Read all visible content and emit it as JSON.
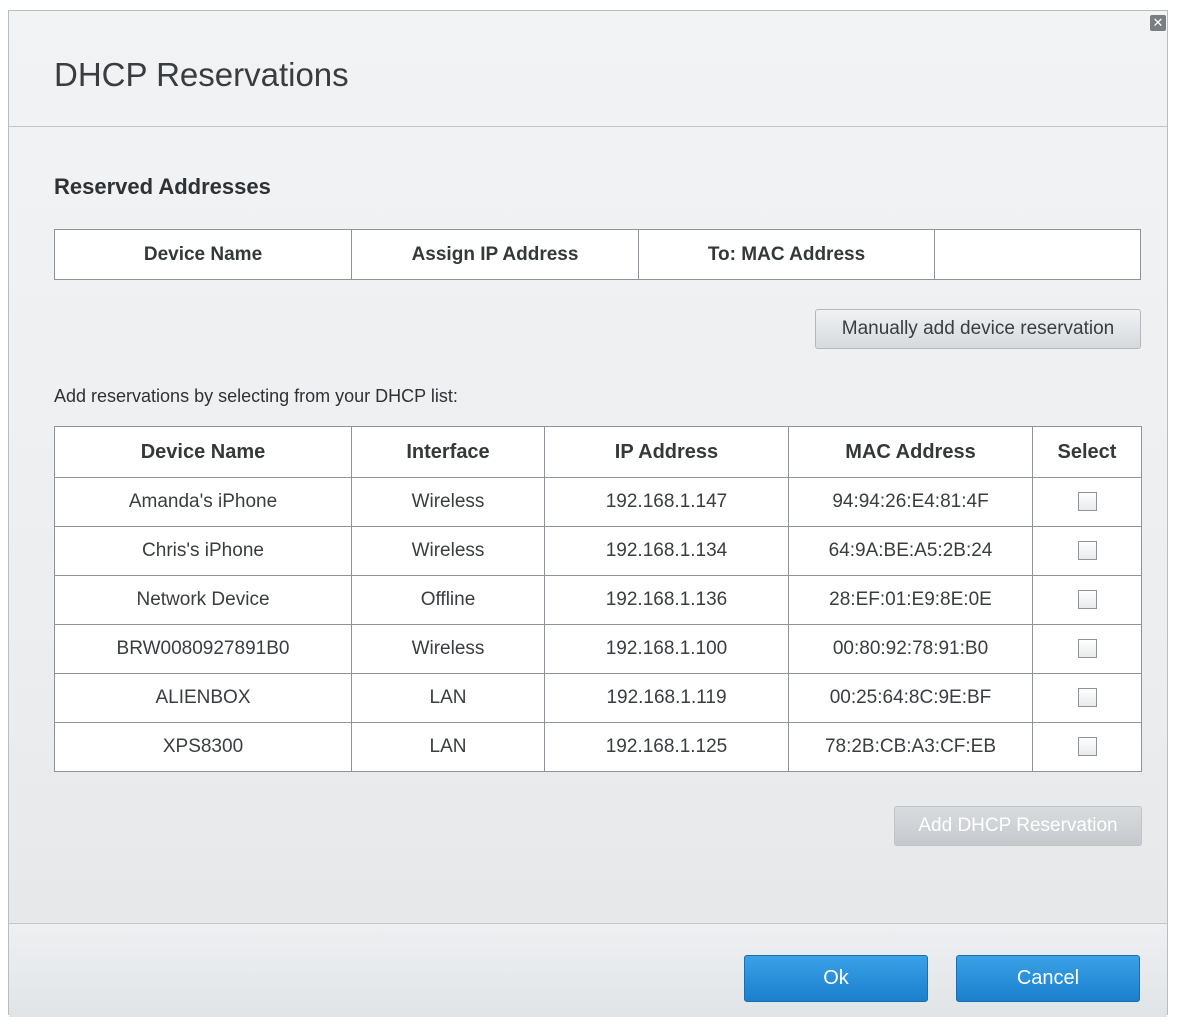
{
  "dialog": {
    "title": "DHCP Reservations",
    "close_glyph": "✕"
  },
  "reserved": {
    "section_title": "Reserved Addresses",
    "columns": [
      "Device Name",
      "Assign IP Address",
      "To: MAC Address",
      ""
    ],
    "manual_add_label": "Manually add device reservation"
  },
  "dhcp_list": {
    "hint": "Add reservations by selecting from your DHCP list:",
    "columns": [
      "Device Name",
      "Interface",
      "IP Address",
      "MAC Address",
      "Select"
    ],
    "rows": [
      {
        "device": "Amanda's iPhone",
        "interface": "Wireless",
        "ip": "192.168.1.147",
        "mac": "94:94:26:E4:81:4F",
        "selected": false
      },
      {
        "device": "Chris's iPhone",
        "interface": "Wireless",
        "ip": "192.168.1.134",
        "mac": "64:9A:BE:A5:2B:24",
        "selected": false
      },
      {
        "device": "Network Device",
        "interface": "Offline",
        "ip": "192.168.1.136",
        "mac": "28:EF:01:E9:8E:0E",
        "selected": false
      },
      {
        "device": "BRW0080927891B0",
        "interface": "Wireless",
        "ip": "192.168.1.100",
        "mac": "00:80:92:78:91:B0",
        "selected": false
      },
      {
        "device": "ALIENBOX",
        "interface": "LAN",
        "ip": "192.168.1.119",
        "mac": "00:25:64:8C:9E:BF",
        "selected": false
      },
      {
        "device": "XPS8300",
        "interface": "LAN",
        "ip": "192.168.1.125",
        "mac": "78:2B:CB:A3:CF:EB",
        "selected": false
      }
    ],
    "add_label": "Add DHCP Reservation"
  },
  "footer": {
    "ok_label": "Ok",
    "cancel_label": "Cancel"
  },
  "colors": {
    "primary_button": "#1b7fcc",
    "disabled_button_text": "#ffffff"
  }
}
